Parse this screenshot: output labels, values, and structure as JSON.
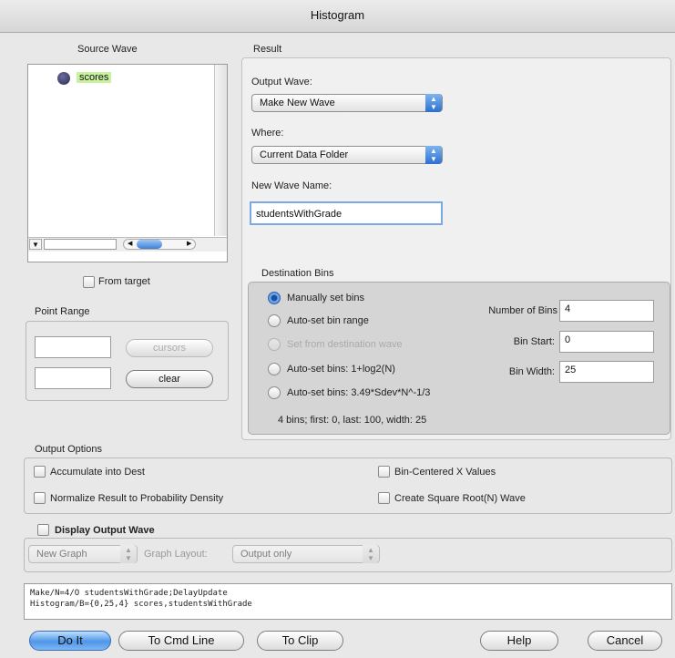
{
  "window": {
    "title": "Histogram"
  },
  "source": {
    "label": "Source Wave",
    "waves": [
      {
        "name": "scores"
      }
    ],
    "from_target_label": "From target",
    "filter_value": ""
  },
  "point_range": {
    "label": "Point Range",
    "start_value": "",
    "end_value": "",
    "cursors_label": "cursors",
    "clear_label": "clear"
  },
  "result": {
    "label": "Result",
    "output_wave_label": "Output Wave:",
    "output_wave_value": "Make New Wave",
    "where_label": "Where:",
    "where_value": "Current Data Folder",
    "new_wave_name_label": "New Wave Name:",
    "new_wave_name_value": "studentsWithGrade"
  },
  "destination_bins": {
    "label": "Destination Bins",
    "options": [
      {
        "label": "Manually set bins",
        "selected": true,
        "enabled": true
      },
      {
        "label": "Auto-set bin range",
        "selected": false,
        "enabled": true
      },
      {
        "label": "Set from destination wave",
        "selected": false,
        "enabled": false
      },
      {
        "label": "Auto-set bins: 1+log2(N)",
        "selected": false,
        "enabled": true
      },
      {
        "label": "Auto-set bins: 3.49*Sdev*N^-1/3",
        "selected": false,
        "enabled": true
      }
    ],
    "number_of_bins_label": "Number of Bins",
    "number_of_bins_value": "4",
    "bin_start_label": "Bin Start:",
    "bin_start_value": "0",
    "bin_width_label": "Bin Width:",
    "bin_width_value": "25",
    "summary": "4 bins; first: 0, last: 100, width: 25"
  },
  "output_options": {
    "label": "Output Options",
    "accumulate": "Accumulate into Dest",
    "normalize": "Normalize Result to Probability Density",
    "bin_centered": "Bin-Centered X Values",
    "sqrt_wave": "Create Square Root(N) Wave",
    "display_output": "Display Output Wave",
    "graph_value": "New Graph",
    "graph_layout_label": "Graph Layout:",
    "graph_layout_value": "Output only"
  },
  "command": {
    "lines": [
      "Make/N=4/O studentsWithGrade;DelayUpdate",
      "Histogram/B={0,25,4} scores,studentsWithGrade"
    ]
  },
  "buttons": {
    "do_it": "Do It",
    "to_cmd_line": "To Cmd Line",
    "to_clip": "To Clip",
    "help": "Help",
    "cancel": "Cancel"
  },
  "colors": {
    "default_button": "#4f95e8",
    "wave_highlight": "#c8f2a0",
    "popup_arrows": "#2c6fd0"
  }
}
